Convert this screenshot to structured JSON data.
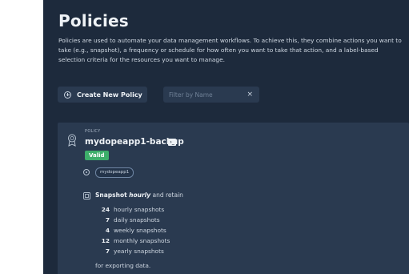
{
  "header": {
    "title": "Policies",
    "description": "Policies are used to automate your data management workflows. To achieve this, they combine actions you want to take (e.g., snapshot), a frequency or schedule for how often you want to take that action, and a label-based selection criteria for the resources you want to manage."
  },
  "toolbar": {
    "create_label": "Create New Policy",
    "filter_placeholder": "Filter by Name",
    "filter_value": "",
    "clear_glyph": "×"
  },
  "policy": {
    "section_label": "POLICY",
    "name": "mydopeapp1-backup",
    "terminal_glyph": "›_",
    "status": "Valid",
    "selector": "mydopeapp1",
    "action": "Snapshot",
    "frequency": "hourly",
    "retain_suffix": "and retain",
    "retention": [
      {
        "count": "24",
        "unit": "hourly snapshots"
      },
      {
        "count": "7",
        "unit": "daily snapshots"
      },
      {
        "count": "4",
        "unit": "weekly snapshots"
      },
      {
        "count": "12",
        "unit": "monthly snapshots"
      },
      {
        "count": "7",
        "unit": "yearly snapshots"
      }
    ],
    "export_note": "for exporting data."
  },
  "colors": {
    "background": "#1d2a3c",
    "card": "#2a3a50",
    "valid": "#3dae6a"
  },
  "icons": [
    "add-circle-icon",
    "clear-icon",
    "policy-badge-icon",
    "terminal-icon",
    "target-icon",
    "snapshot-icon"
  ]
}
